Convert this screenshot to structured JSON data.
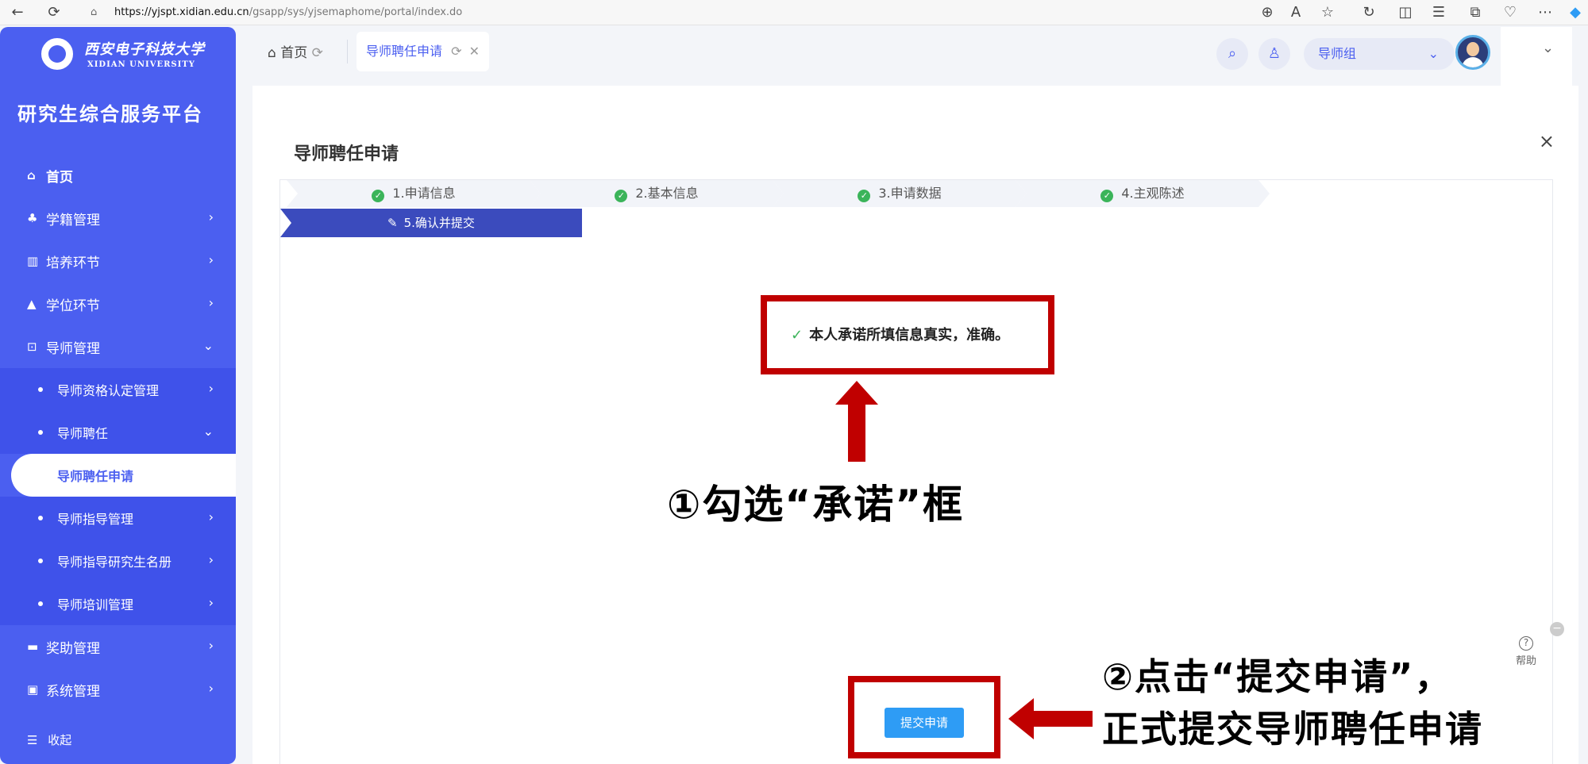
{
  "browser": {
    "url_host": "https://yjspt.xidian.edu.cn",
    "url_path": "/gsapp/sys/yjsemaphome/portal/index.do"
  },
  "sidebar": {
    "logo_cn": "西安电子科技大学",
    "logo_en": "XIDIAN UNIVERSITY",
    "platform_title": "研究生综合服务平台",
    "items": [
      {
        "label": "首页"
      },
      {
        "label": "学籍管理"
      },
      {
        "label": "培养环节"
      },
      {
        "label": "学位环节"
      },
      {
        "label": "导师管理"
      },
      {
        "label": "奖助管理"
      },
      {
        "label": "系统管理"
      }
    ],
    "sub_items": [
      {
        "label": "导师资格认定管理"
      },
      {
        "label": "导师聘任"
      },
      {
        "label": "导师聘任申请"
      },
      {
        "label": "导师指导管理"
      },
      {
        "label": "导师指导研究生名册"
      },
      {
        "label": "导师培训管理"
      }
    ],
    "collapse_label": "收起"
  },
  "header": {
    "home_tab": "首页",
    "active_tab": "导师聘任申请",
    "group_select": "导师组"
  },
  "main": {
    "title": "导师聘任申请",
    "steps": [
      {
        "label": "1.申请信息"
      },
      {
        "label": "2.基本信息"
      },
      {
        "label": "3.申请数据"
      },
      {
        "label": "4.主观陈述"
      },
      {
        "label": "5.确认并提交"
      }
    ],
    "promise_text": "本人承诺所填信息真实，准确。",
    "submit_label": "提交申请",
    "annotation_1": "①勾选“承诺”框",
    "annotation_2_line1": "②点击“提交申请”，",
    "annotation_2_line2": "正式提交导师聘任申请",
    "help_label": "帮助"
  },
  "colors": {
    "sidebar": "#4b5ff0",
    "annotation_red": "#c00000",
    "submit_blue": "#2e9cf5",
    "step_active": "#3b4bbd"
  }
}
